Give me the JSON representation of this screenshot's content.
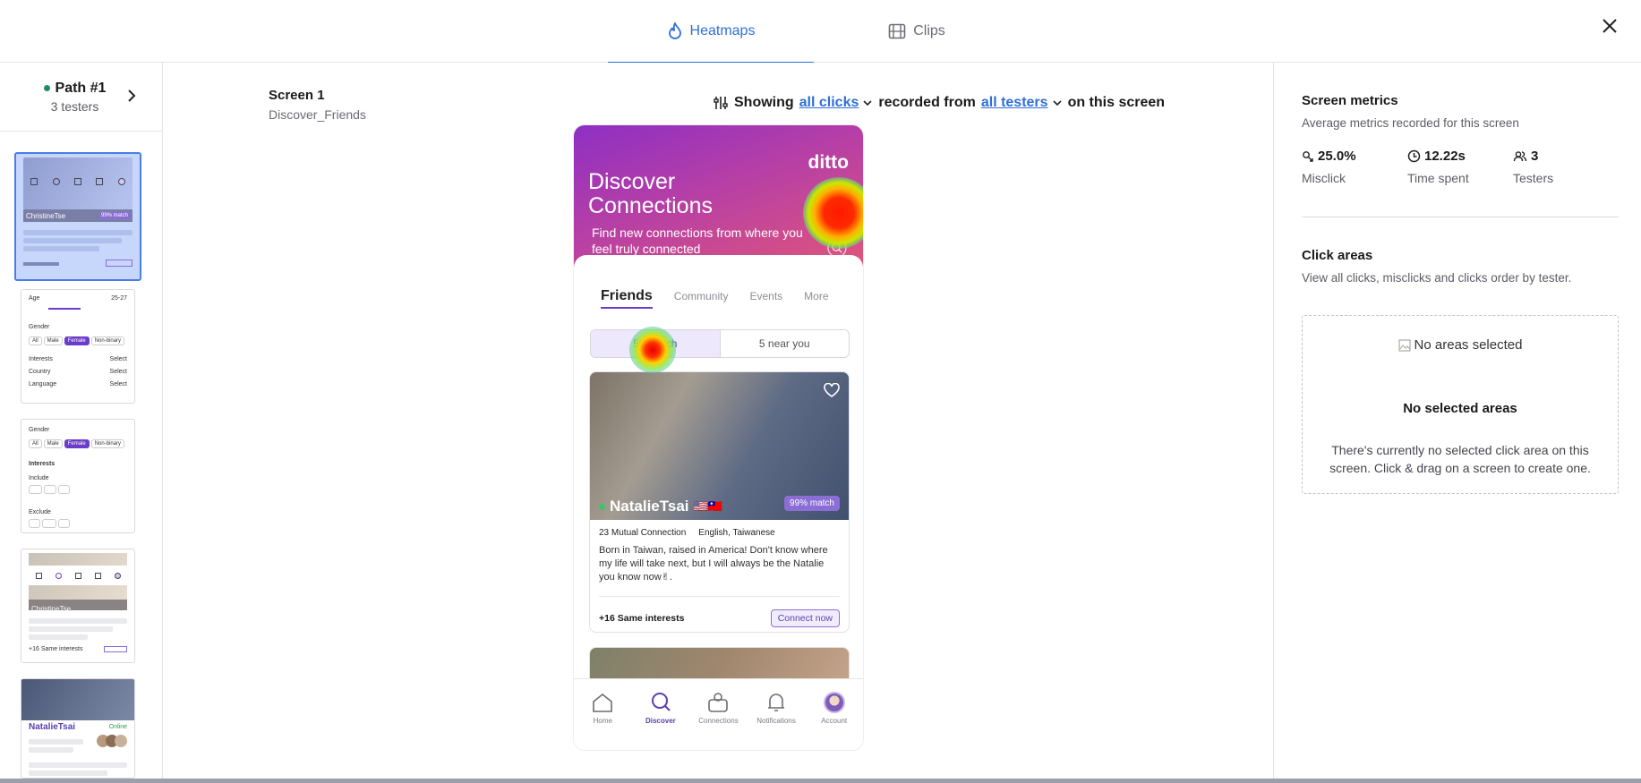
{
  "tabs": [
    {
      "label": "Heatmaps",
      "active": true,
      "icon": "flame-icon"
    },
    {
      "label": "Clips",
      "active": false,
      "icon": "film-icon"
    }
  ],
  "path": {
    "title": "Path #1",
    "testers": "3 testers"
  },
  "thumbnails": {
    "t1": {
      "name": "ChristineTse",
      "badge": "99% match"
    },
    "t2": {
      "age": "Age",
      "age_range": "25-27",
      "gender": "Gender",
      "opts": [
        "All",
        "Male",
        "Female",
        "Non-binary"
      ],
      "rows": [
        "Interests",
        "Country",
        "Language"
      ],
      "select": "Select"
    },
    "t3": {
      "gender": "Gender",
      "opts": [
        "All",
        "Male",
        "Female",
        "Non-binary"
      ],
      "interests": "Interests",
      "include": "Include",
      "exclude": "Exclude"
    },
    "t4": {
      "name": "ChristineTse",
      "footer": "+16 Same interests"
    },
    "t5": {
      "name": "NatalieTsai",
      "status": "Online"
    }
  },
  "screen": {
    "name": "Screen 1",
    "id": "Discover_Friends"
  },
  "filter": {
    "showing": "Showing",
    "clicks": "all clicks",
    "recorded_from": "recorded from",
    "testers": "all testers",
    "suffix": "on this screen"
  },
  "phone": {
    "logo": "ditto",
    "title": "Discover Connections",
    "subtitle": "Find new connections from where you feel truly connected",
    "tabs": [
      "Friends",
      "Community",
      "Events",
      "More"
    ],
    "seg_left": "56 match",
    "seg_right": "5 near you",
    "card": {
      "name": "NatalieTsai",
      "flags": "🇺🇸🇹🇼",
      "badge": "99% match",
      "mutual": "23 Mutual Connection",
      "languages": "English, Taiwanese",
      "bio": "Born in Taiwan, raised in America! Don't know where my life will take next, but I will always be the Natalie you know now✌.",
      "interests": "+16 Same interests",
      "connect": "Connect now"
    },
    "nav": [
      "Home",
      "Discover",
      "Connections",
      "Notifications",
      "Account"
    ]
  },
  "metrics": {
    "title": "Screen metrics",
    "subtitle": "Average metrics recorded for this screen",
    "items": [
      {
        "value": "25.0%",
        "label": "Misclick",
        "icon": "misclick-icon"
      },
      {
        "value": "12.22s",
        "label": "Time spent",
        "icon": "clock-icon"
      },
      {
        "value": "3",
        "label": "Testers",
        "icon": "users-icon"
      }
    ]
  },
  "click_areas": {
    "title": "Click areas",
    "subtitle": "View all clicks, misclicks and clicks order by tester.",
    "img_alt": "No areas selected",
    "empty_title": "No selected areas",
    "empty_text": "There's currently no selected click area on this screen. Click & drag on a screen to create one."
  },
  "colors": {
    "accent": "#2f6fd8",
    "brand": "#6a3cc8",
    "path_dot": "#1e8a6e"
  }
}
